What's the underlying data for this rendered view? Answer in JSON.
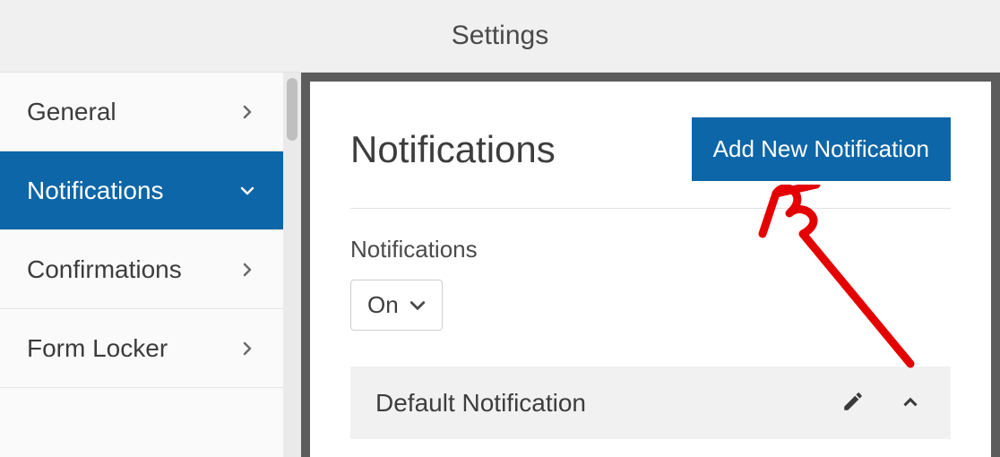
{
  "header": {
    "title": "Settings"
  },
  "sidebar": {
    "items": [
      {
        "label": "General",
        "active": false,
        "expanded": false
      },
      {
        "label": "Notifications",
        "active": true,
        "expanded": true
      },
      {
        "label": "Confirmations",
        "active": false,
        "expanded": false
      },
      {
        "label": "Form Locker",
        "active": false,
        "expanded": false
      }
    ]
  },
  "panel": {
    "title": "Notifications",
    "add_button_label": "Add New Notification",
    "toggle": {
      "label": "Notifications",
      "value": "On"
    },
    "items": [
      {
        "title": "Default Notification"
      }
    ]
  },
  "colors": {
    "accent": "#0d66a8"
  }
}
